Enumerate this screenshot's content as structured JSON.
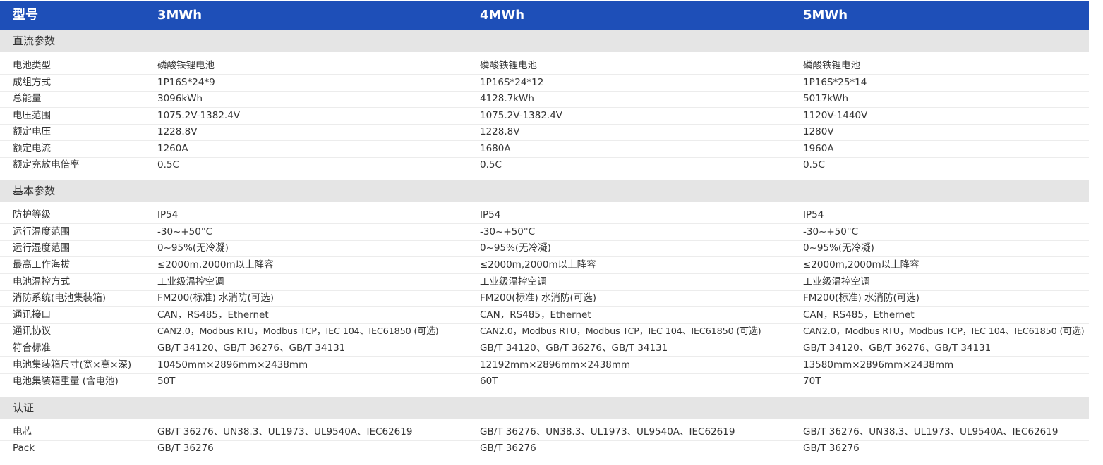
{
  "header": {
    "label": "型号",
    "models": [
      "3MWh",
      "4MWh",
      "5MWh"
    ]
  },
  "sections": [
    {
      "title": "直流参数",
      "rows": [
        {
          "label": "电池类型",
          "values": [
            "磷酸铁锂电池",
            "磷酸铁锂电池",
            "磷酸铁锂电池"
          ]
        },
        {
          "label": "成组方式",
          "values": [
            "1P16S*24*9",
            "1P16S*24*12",
            "1P16S*25*14"
          ]
        },
        {
          "label": "总能量",
          "values": [
            "3096kWh",
            "4128.7kWh",
            "5017kWh"
          ]
        },
        {
          "label": "电压范围",
          "values": [
            "1075.2V-1382.4V",
            "1075.2V-1382.4V",
            "1120V-1440V"
          ]
        },
        {
          "label": "额定电压",
          "values": [
            "1228.8V",
            "1228.8V",
            "1280V"
          ]
        },
        {
          "label": "额定电流",
          "values": [
            "1260A",
            "1680A",
            "1960A"
          ]
        },
        {
          "label": "额定充放电倍率",
          "values": [
            "0.5C",
            "0.5C",
            "0.5C"
          ]
        }
      ]
    },
    {
      "title": "基本参数",
      "rows": [
        {
          "label": "防护等级",
          "values": [
            "IP54",
            "IP54",
            "IP54"
          ]
        },
        {
          "label": "运行温度范围",
          "values": [
            "-30~+50°C",
            "-30~+50°C",
            "-30~+50°C"
          ]
        },
        {
          "label": "运行湿度范围",
          "values": [
            "0~95%(无冷凝)",
            "0~95%(无冷凝)",
            "0~95%(无冷凝)"
          ]
        },
        {
          "label": "最高工作海拔",
          "values": [
            "≤2000m,2000m以上降容",
            "≤2000m,2000m以上降容",
            "≤2000m,2000m以上降容"
          ]
        },
        {
          "label": "电池温控方式",
          "values": [
            "工业级温控空调",
            "工业级温控空调",
            "工业级温控空调"
          ]
        },
        {
          "label": "消防系统(电池集装箱)",
          "values": [
            "FM200(标准) 水消防(可选)",
            "FM200(标准) 水消防(可选)",
            "FM200(标准) 水消防(可选)"
          ]
        },
        {
          "label": "通讯接口",
          "values": [
            "CAN，RS485，Ethernet",
            "CAN，RS485，Ethernet",
            "CAN，RS485，Ethernet"
          ]
        },
        {
          "label": "通讯协议",
          "values": [
            "CAN2.0，Modbus RTU，Modbus TCP，IEC 104、IEC61850 (可选)",
            "CAN2.0，Modbus RTU，Modbus TCP，IEC 104、IEC61850 (可选)",
            "CAN2.0，Modbus RTU，Modbus TCP，IEC 104、IEC61850 (可选)"
          ]
        },
        {
          "label": "符合标准",
          "values": [
            "GB/T 34120、GB/T 36276、GB/T 34131",
            "GB/T 34120、GB/T 36276、GB/T 34131",
            "GB/T 34120、GB/T 36276、GB/T 34131"
          ]
        },
        {
          "label": "电池集装箱尺寸(宽×高×深)",
          "values": [
            "10450mm×2896mm×2438mm",
            "12192mm×2896mm×2438mm",
            "13580mm×2896mm×2438mm"
          ]
        },
        {
          "label": "电池集装箱重量 (含电池)",
          "values": [
            "50T",
            "60T",
            "70T"
          ]
        }
      ]
    },
    {
      "title": "认证",
      "rows": [
        {
          "label": "电芯",
          "values": [
            "GB/T 36276、UN38.3、UL1973、UL9540A、IEC62619",
            "GB/T 36276、UN38.3、UL1973、UL9540A、IEC62619",
            "GB/T 36276、UN38.3、UL1973、UL9540A、IEC62619"
          ]
        },
        {
          "label": "Pack",
          "values": [
            "GB/T 36276",
            "GB/T 36276",
            "GB/T 36276"
          ]
        }
      ]
    }
  ]
}
